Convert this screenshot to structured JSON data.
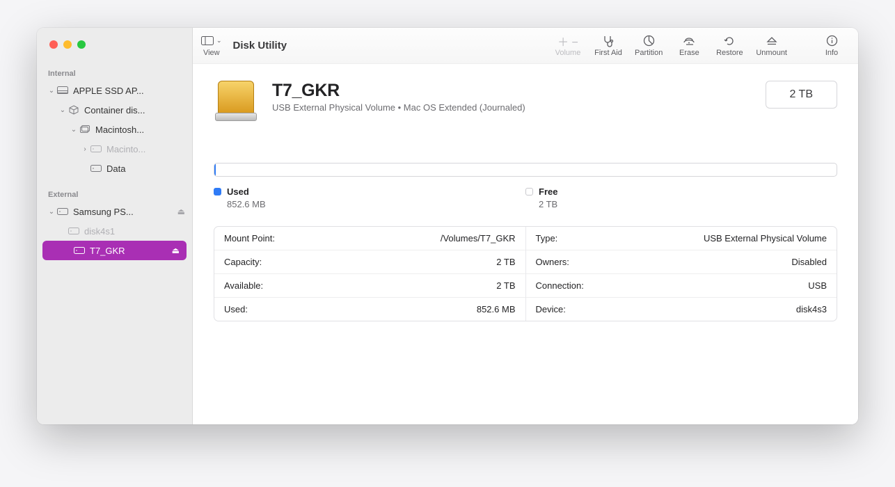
{
  "app_title": "Disk Utility",
  "toolbar": {
    "view_label": "View",
    "volume_label": "Volume",
    "first_aid_label": "First Aid",
    "partition_label": "Partition",
    "erase_label": "Erase",
    "restore_label": "Restore",
    "unmount_label": "Unmount",
    "info_label": "Info"
  },
  "sidebar": {
    "internal_label": "Internal",
    "external_label": "External",
    "internal": [
      {
        "label": "APPLE SSD AP..."
      },
      {
        "label": "Container dis..."
      },
      {
        "label": "Macintosh..."
      },
      {
        "label": "Macinto..."
      },
      {
        "label": "Data"
      }
    ],
    "external": [
      {
        "label": "Samsung PS..."
      },
      {
        "label": "disk4s1"
      },
      {
        "label": "T7_GKR"
      }
    ]
  },
  "volume": {
    "name": "T7_GKR",
    "subtitle": "USB External Physical Volume • Mac OS Extended (Journaled)",
    "size_badge": "2 TB",
    "used_label": "Used",
    "used_value": "852.6 MB",
    "free_label": "Free",
    "free_value": "2 TB"
  },
  "details": {
    "left": [
      {
        "k": "Mount Point:",
        "v": "/Volumes/T7_GKR"
      },
      {
        "k": "Capacity:",
        "v": "2 TB"
      },
      {
        "k": "Available:",
        "v": "2 TB"
      },
      {
        "k": "Used:",
        "v": "852.6 MB"
      }
    ],
    "right": [
      {
        "k": "Type:",
        "v": "USB External Physical Volume"
      },
      {
        "k": "Owners:",
        "v": "Disabled"
      },
      {
        "k": "Connection:",
        "v": "USB"
      },
      {
        "k": "Device:",
        "v": "disk4s3"
      }
    ]
  }
}
